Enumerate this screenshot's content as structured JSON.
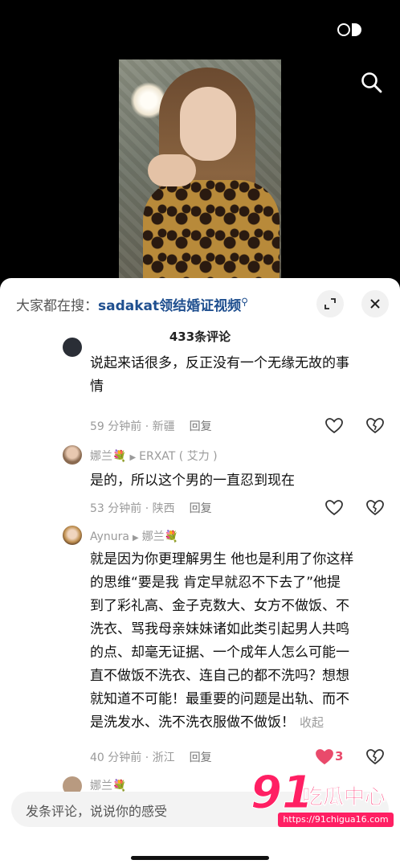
{
  "search": {
    "prefix": "大家都在搜：",
    "term": "sadakat领结婚证视频"
  },
  "comment_count_title": "433条评论",
  "comments": [
    {
      "name": "",
      "text_line1": "说起来话很多，反正没有一个无缘无故的事",
      "text_line2": "情",
      "meta": "59 分钟前 · 新疆",
      "reply": "回复"
    },
    {
      "name": "娜兰💐",
      "reply_to": "ERXAT ( 艾力 )",
      "text_line1": "是的，所以这个男的一直忍到现在",
      "meta": "53 分钟前 · 陕西",
      "reply": "回复"
    },
    {
      "name": "Aynura",
      "reply_to": "娜兰💐",
      "lines": [
        "就是因为你更理解男生 他也是利用了你这样",
        "的思维“要是我 肯定早就忍不下去了”他提",
        "到了彩礼高、金子克数大、女方不做饭、不",
        "洗衣、骂我母亲妹妹诸如此类引起男人共鸣",
        "的点、却毫无证据、一个成年人怎么可能一",
        "直不做饭不洗衣、连自己的都不洗吗？想想",
        "就知道不可能！最重要的问题是出轨、而不",
        "是洗发水、洗不洗衣服做不做饭！"
      ],
      "collapse": "收起",
      "meta": "40 分钟前 · 浙江",
      "reply": "回复",
      "likes": "3"
    }
  ],
  "next_comment_name": "娜兰💐",
  "input_placeholder": "发条评论，说说你的感受",
  "watermark": {
    "logo_num": "91",
    "brand": "吃瓜中心",
    "url": "https://91chigua16.com"
  },
  "icons": {
    "top_search": "search-icon",
    "toggle": "toggle-icon",
    "expand": "expand-icon",
    "close": "close-icon",
    "like": "heart-icon",
    "dislike": "broken-heart-icon"
  },
  "colors": {
    "accent_link": "#1f4f8f",
    "like_red": "#e94a6b",
    "watermark_pink": "#ff1f63"
  }
}
